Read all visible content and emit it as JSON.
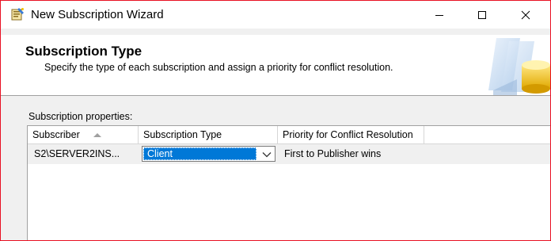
{
  "window": {
    "title": "New Subscription Wizard",
    "accent_border": "#e81123"
  },
  "titlebar": {
    "icons": [
      "wizard-app-icon",
      "minimize-icon",
      "maximize-icon",
      "close-icon"
    ]
  },
  "header": {
    "title": "Subscription Type",
    "subtitle": "Specify the type of each subscription and assign a priority for conflict resolution.",
    "graphic": "database-wizard-graphic"
  },
  "main": {
    "properties_label": "Subscription properties:",
    "grid": {
      "columns": [
        {
          "label": "Subscriber",
          "sorted": "ascending"
        },
        {
          "label": "Subscription Type"
        },
        {
          "label": "Priority for Conflict Resolution"
        }
      ],
      "rows": [
        {
          "subscriber": "S2\\SERVER2INS...",
          "subscription_type": "Client",
          "priority": "First to Publisher wins"
        }
      ]
    }
  },
  "colors": {
    "selection": "#0078d7",
    "window_bg": "#f0f0f0"
  }
}
